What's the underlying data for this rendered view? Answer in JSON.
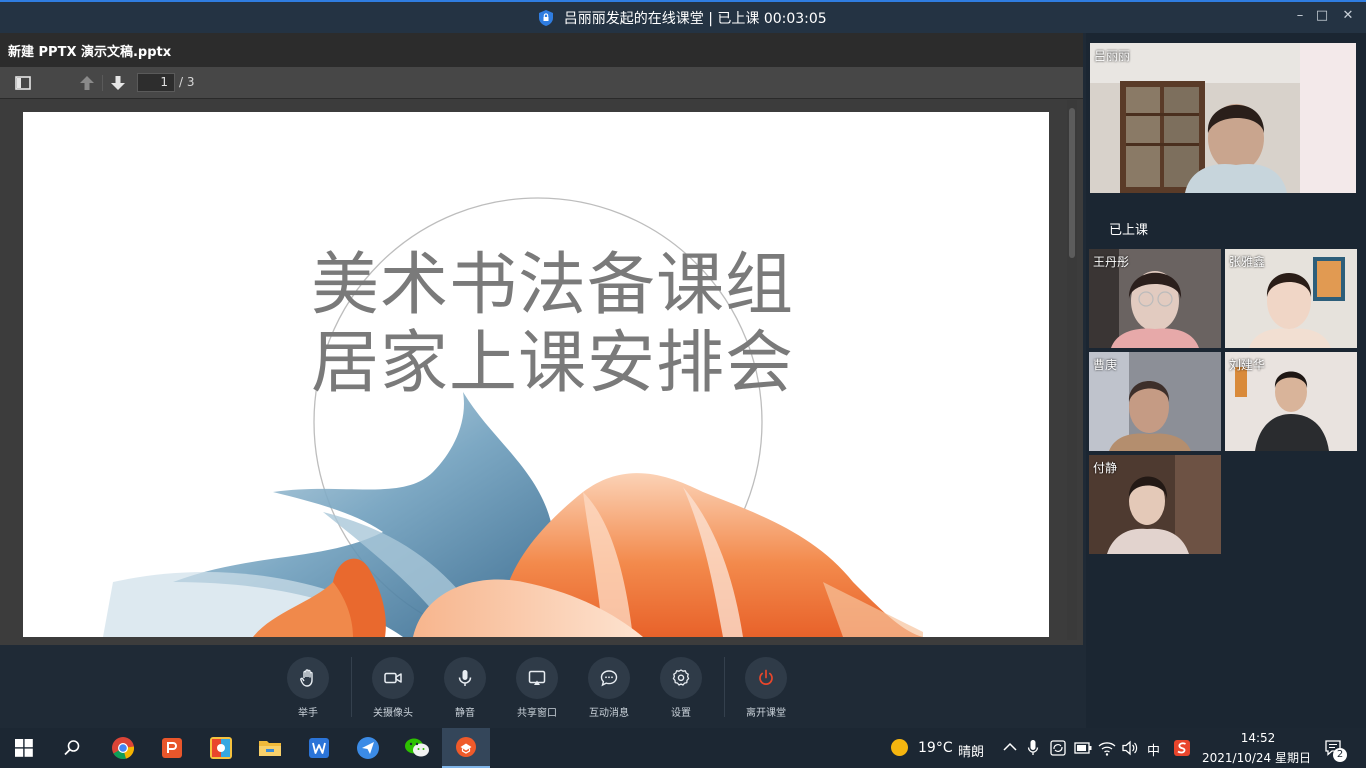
{
  "window": {
    "title": "吕丽丽发起的在线课堂 | 已上课 00:03:05"
  },
  "document": {
    "filename": "新建 PPTX 演示文稿.pptx",
    "page_current": "1",
    "page_total": "/ 3",
    "slide_title_line1": "美术书法备课组",
    "slide_title_line2": "居家上课安排会"
  },
  "controls": [
    {
      "label": "举手",
      "icon": "raise-hand-icon"
    },
    {
      "label": "关摄像头",
      "icon": "camera-icon"
    },
    {
      "label": "静音",
      "icon": "microphone-icon"
    },
    {
      "label": "共享窗口",
      "icon": "share-screen-icon"
    },
    {
      "label": "互动消息",
      "icon": "chat-icon"
    },
    {
      "label": "设置",
      "icon": "gear-icon"
    },
    {
      "label": "离开课堂",
      "icon": "power-icon"
    }
  ],
  "participants": {
    "host": {
      "name": "吕丽丽"
    },
    "section_label": "已上课",
    "attendees": [
      {
        "name": "王丹彤"
      },
      {
        "name": "张雅鑫"
      },
      {
        "name": "曹庚"
      },
      {
        "name": "刘建华"
      },
      {
        "name": "付静"
      }
    ]
  },
  "taskbar": {
    "apps": [
      "chrome-icon",
      "powerpoint-icon",
      "pinyin-app-icon",
      "file-explorer-icon",
      "wps-writer-icon",
      "feishu-icon",
      "wechat-icon",
      "classroom-app-icon"
    ],
    "weather_temp": "19°C",
    "weather_desc": "晴朗",
    "ime": "中",
    "time": "14:52",
    "date": "2021/10/24 星期日",
    "notification_count": "2"
  },
  "colors": {
    "accent": "#2f7de1",
    "leave": "#e8462b"
  }
}
